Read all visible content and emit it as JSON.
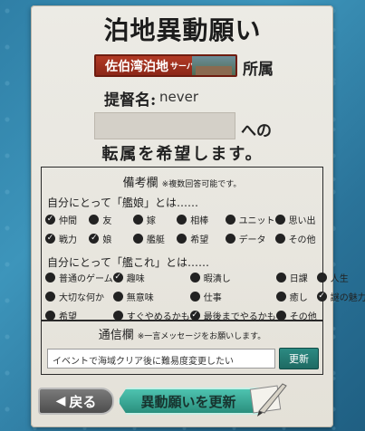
{
  "title": "泊地異動願い",
  "base": {
    "name": "佐伯湾泊地",
    "server": "サーバ"
  },
  "affiliation_label": "所属",
  "admiral": {
    "label": "提督名:",
    "name": "never"
  },
  "transfer": {
    "to_label": "への",
    "request_text": "転属を希望します。"
  },
  "remarks": {
    "title": "備考欄",
    "note": "※複数回答可能です。",
    "q1": {
      "title": "自分にとって「艦娘」とは……",
      "options": [
        {
          "label": "仲間",
          "checked": true
        },
        {
          "label": "友",
          "checked": false
        },
        {
          "label": "嫁",
          "checked": false
        },
        {
          "label": "相棒",
          "checked": false
        },
        {
          "label": "ユニット",
          "checked": false
        },
        {
          "label": "思い出",
          "checked": false
        },
        {
          "label": "戦力",
          "checked": true
        },
        {
          "label": "娘",
          "checked": true
        },
        {
          "label": "艦艇",
          "checked": false
        },
        {
          "label": "希望",
          "checked": false
        },
        {
          "label": "データ",
          "checked": false
        },
        {
          "label": "その他",
          "checked": false
        }
      ]
    },
    "q2": {
      "title": "自分にとって「艦これ」とは……",
      "options": [
        {
          "label": "普通のゲーム",
          "checked": false
        },
        {
          "label": "趣味",
          "checked": true
        },
        {
          "label": "暇潰し",
          "checked": false
        },
        {
          "label": "日課",
          "checked": false
        },
        {
          "label": "人生",
          "checked": false
        },
        {
          "label": "大切な何か",
          "checked": false
        },
        {
          "label": "無意味",
          "checked": false
        },
        {
          "label": "仕事",
          "checked": false
        },
        {
          "label": "癒し",
          "checked": false
        },
        {
          "label": "謎の魅力",
          "checked": true
        },
        {
          "label": "希望",
          "checked": false
        },
        {
          "label": "すぐやめるかも",
          "checked": false
        },
        {
          "label": "最後までやるかも",
          "checked": true
        },
        {
          "label": "その他",
          "checked": false
        }
      ]
    }
  },
  "comm": {
    "title": "通信欄",
    "note": "※一言メッセージをお願いします。",
    "message": "イベントで海域クリア後に難易度変更したい",
    "update_label": "更新"
  },
  "buttons": {
    "back_label": "戻る",
    "submit_label": "異動願いを更新"
  }
}
